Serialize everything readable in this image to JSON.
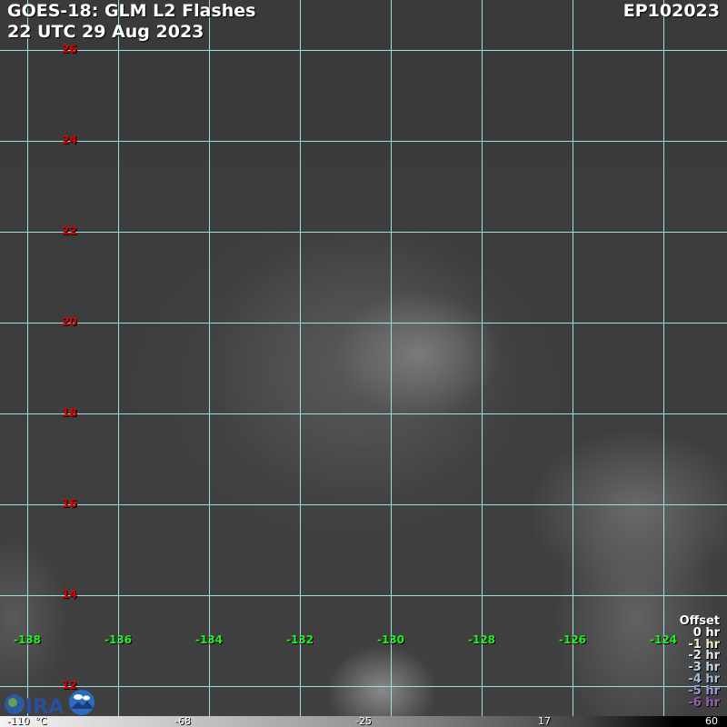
{
  "header": {
    "title": "GOES-18: GLM L2 Flashes",
    "timestamp": "22 UTC 29 Aug 2023",
    "storm_id": "EP102023"
  },
  "latitudes": [
    "26",
    "24",
    "22",
    "20",
    "18",
    "16",
    "14",
    "12"
  ],
  "longitudes": [
    "-138",
    "-136",
    "-134",
    "-132",
    "-130",
    "-128",
    "-126",
    "-124"
  ],
  "legend": {
    "title": "Offset",
    "items": [
      {
        "label": "0 hr",
        "color": "#ffffff"
      },
      {
        "label": "-1 hr",
        "color": "#f4f0c8"
      },
      {
        "label": "-2 hr",
        "color": "#dfe8ee"
      },
      {
        "label": "-3 hr",
        "color": "#c4d6ea"
      },
      {
        "label": "-4 hr",
        "color": "#a8bee0"
      },
      {
        "label": "-5 hr",
        "color": "#9a9ad2"
      },
      {
        "label": "-6 hr",
        "color": "#9060b0"
      }
    ]
  },
  "colorbar": {
    "labels": [
      "-110",
      "°C",
      "-68",
      "-25",
      "17",
      "60"
    ]
  },
  "grid_color": "#9ee0e2"
}
